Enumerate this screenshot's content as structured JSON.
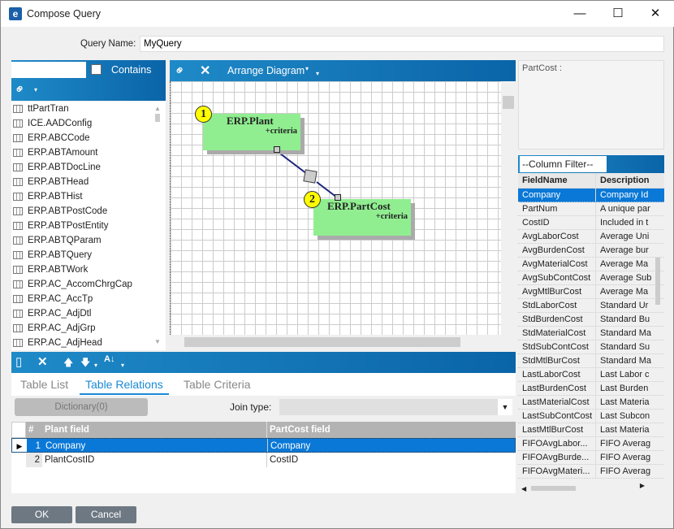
{
  "window": {
    "title": "Compose Query",
    "minimize": "—",
    "maximize": "☐",
    "close": "✕"
  },
  "query_name": {
    "label": "Query Name:",
    "value": "MyQuery"
  },
  "table_search": {
    "value": "",
    "contains_label": "Contains",
    "contains_checked": false
  },
  "tables": [
    "ttPartTran",
    "ICE.AADConfig",
    "ERP.ABCCode",
    "ERP.ABTAmount",
    "ERP.ABTDocLine",
    "ERP.ABTHead",
    "ERP.ABTHist",
    "ERP.ABTPostCode",
    "ERP.ABTPostEntity",
    "ERP.ABTQParam",
    "ERP.ABTQuery",
    "ERP.ABTWork",
    "ERP.AC_AccomChrgCap",
    "ERP.AC_AccTp",
    "ERP.AC_AdjDtl",
    "ERP.AC_AdjGrp",
    "ERP.AC_AdjHead"
  ],
  "diagram": {
    "arrange_label": "Arrange Diagram",
    "nodes": [
      {
        "num": "1",
        "name": "ERP.Plant",
        "criteria": "+criteria"
      },
      {
        "num": "2",
        "name": "ERP.PartCost",
        "criteria": "+criteria"
      }
    ]
  },
  "field_panel": {
    "title": "PartCost :",
    "filter": "--Column Filter--",
    "col_field": "FieldName",
    "col_desc": "Description",
    "rows": [
      [
        "Company",
        "Company Id"
      ],
      [
        "PartNum",
        "A unique par"
      ],
      [
        "CostID",
        "Included in t"
      ],
      [
        "AvgLaborCost",
        "Average Uni"
      ],
      [
        "AvgBurdenCost",
        "Average bur"
      ],
      [
        "AvgMaterialCost",
        "Average Ma"
      ],
      [
        "AvgSubContCost",
        "Average Sub"
      ],
      [
        "AvgMtlBurCost",
        "Average Ma"
      ],
      [
        "StdLaborCost",
        "Standard Ur"
      ],
      [
        "StdBurdenCost",
        "Standard Bu"
      ],
      [
        "StdMaterialCost",
        "Standard Ma"
      ],
      [
        "StdSubContCost",
        "Standard Su"
      ],
      [
        "StdMtlBurCost",
        "Standard Ma"
      ],
      [
        "LastLaborCost",
        "Last Labor c"
      ],
      [
        "LastBurdenCost",
        "Last Burden"
      ],
      [
        "LastMaterialCost",
        "Last Materia"
      ],
      [
        "LastSubContCost",
        "Last Subcon"
      ],
      [
        "LastMtlBurCost",
        "Last Materia"
      ],
      [
        "FIFOAvgLabor...",
        "FIFO Averag"
      ],
      [
        "FIFOAvgBurde...",
        "FIFO Averag"
      ],
      [
        "FIFOAvgMateri...",
        "FIFO Averag"
      ]
    ]
  },
  "tabs": [
    "Table List",
    "Table Relations",
    "Table Criteria"
  ],
  "relations": {
    "dictionary": "Dictionary(0)",
    "join_label": "Join type:",
    "join_value": "",
    "col_num": "#",
    "col_left": "Plant field",
    "col_right": "PartCost field",
    "rows": [
      [
        "1",
        "Company",
        "Company"
      ],
      [
        "2",
        "PlantCostID",
        "CostID"
      ]
    ]
  },
  "buttons": {
    "ok": "OK",
    "cancel": "Cancel"
  }
}
